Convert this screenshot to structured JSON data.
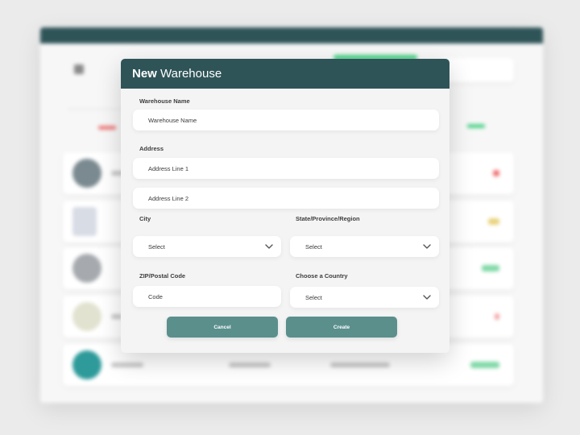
{
  "modal": {
    "title_bold": "New",
    "title_rest": " Warehouse",
    "warehouse_name": {
      "label": "Warehouse Name",
      "placeholder": "Warehouse Name"
    },
    "address": {
      "label": "Address",
      "line1_placeholder": "Address Line 1",
      "line2_placeholder": "Address Line 2"
    },
    "city": {
      "label": "City",
      "value": "Select"
    },
    "state": {
      "label": "State/Province/Region",
      "value": "Select"
    },
    "zip": {
      "label": "ZIP/Postal Code",
      "placeholder": "Code"
    },
    "country": {
      "label": "Choose a Country",
      "value": "Select"
    },
    "cancel_label": "Cancel",
    "create_label": "Create"
  },
  "colors": {
    "header_bg": "#2f5458",
    "button_bg": "#5a8f8c",
    "modal_bg": "#f4f4f4"
  },
  "icons": {
    "dropdown": "chevron-down-icon"
  }
}
